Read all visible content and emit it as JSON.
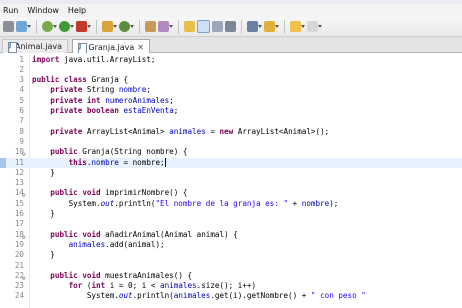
{
  "menubar": {
    "items": [
      "Run",
      "Window",
      "Help"
    ]
  },
  "toolbar": {
    "icons": [
      "print-icon",
      "new-icon",
      "debug-icon",
      "run-icon",
      "external-tools-icon",
      "new-project-icon",
      "new-class-icon",
      "open-type-icon",
      "search-icon",
      "toggle-mark-occurrences-icon",
      "show-whitespace-icon",
      "block-selection-icon",
      "next-annotation-icon",
      "previous-annotation-icon",
      "last-edit-icon",
      "back-icon",
      "forward-icon"
    ]
  },
  "tabs": [
    {
      "label": "Animal.java",
      "active": false
    },
    {
      "label": "Granja.java",
      "active": true,
      "close": "✕"
    }
  ],
  "editor": {
    "current_line": 11,
    "lines": [
      {
        "n": "1",
        "tokens": [
          [
            "kw",
            "import"
          ],
          [
            "t",
            " java.util.ArrayList;"
          ]
        ]
      },
      {
        "n": "2",
        "tokens": []
      },
      {
        "n": "3",
        "tokens": [
          [
            "kw",
            "public"
          ],
          [
            "t",
            " "
          ],
          [
            "kw",
            "class"
          ],
          [
            "t",
            " Granja {"
          ]
        ]
      },
      {
        "n": "4",
        "tokens": [
          [
            "t",
            "    "
          ],
          [
            "kw",
            "private"
          ],
          [
            "t",
            " String "
          ],
          [
            "fld",
            "nombre"
          ],
          [
            "t",
            ";"
          ]
        ]
      },
      {
        "n": "5",
        "tokens": [
          [
            "t",
            "    "
          ],
          [
            "kw",
            "private"
          ],
          [
            "t",
            " "
          ],
          [
            "kw",
            "int"
          ],
          [
            "t",
            " "
          ],
          [
            "fld",
            "numeroAnimales"
          ],
          [
            "t",
            ";"
          ]
        ]
      },
      {
        "n": "6",
        "tokens": [
          [
            "t",
            "    "
          ],
          [
            "kw",
            "private"
          ],
          [
            "t",
            " "
          ],
          [
            "kw",
            "boolean"
          ],
          [
            "t",
            " "
          ],
          [
            "fld",
            "estaEnVenta"
          ],
          [
            "t",
            ";"
          ]
        ]
      },
      {
        "n": "7",
        "tokens": []
      },
      {
        "n": "8",
        "tokens": [
          [
            "t",
            "    "
          ],
          [
            "kw",
            "private"
          ],
          [
            "t",
            " ArrayList<Animal> "
          ],
          [
            "fld",
            "animales"
          ],
          [
            "t",
            " = "
          ],
          [
            "kw",
            "new"
          ],
          [
            "t",
            " ArrayList<Animal>();"
          ]
        ]
      },
      {
        "n": "9",
        "tokens": []
      },
      {
        "n": "10",
        "fold": "⊖",
        "tokens": [
          [
            "t",
            "    "
          ],
          [
            "kw",
            "public"
          ],
          [
            "t",
            " Granja(String nombre) {"
          ]
        ]
      },
      {
        "n": "11",
        "tokens": [
          [
            "t",
            "        "
          ],
          [
            "kw",
            "this"
          ],
          [
            "t",
            "."
          ],
          [
            "fld",
            "nombre"
          ],
          [
            "t",
            " = nombre;"
          ]
        ]
      },
      {
        "n": "12",
        "tokens": [
          [
            "t",
            "    }"
          ]
        ]
      },
      {
        "n": "13",
        "tokens": []
      },
      {
        "n": "14",
        "fold": "⊖",
        "tokens": [
          [
            "t",
            "    "
          ],
          [
            "kw",
            "public"
          ],
          [
            "t",
            " "
          ],
          [
            "kw",
            "void"
          ],
          [
            "t",
            " imprimirNombre() {"
          ]
        ]
      },
      {
        "n": "15",
        "tokens": [
          [
            "t",
            "        System."
          ],
          [
            "fldst",
            "out"
          ],
          [
            "t",
            ".println("
          ],
          [
            "str",
            "\"El nombre de la granja es: \""
          ],
          [
            "t",
            " + "
          ],
          [
            "fld",
            "nombre"
          ],
          [
            "t",
            ");"
          ]
        ]
      },
      {
        "n": "16",
        "tokens": [
          [
            "t",
            "    }"
          ]
        ]
      },
      {
        "n": "17",
        "tokens": []
      },
      {
        "n": "18",
        "fold": "⊖",
        "tokens": [
          [
            "t",
            "    "
          ],
          [
            "kw",
            "public"
          ],
          [
            "t",
            " "
          ],
          [
            "kw",
            "void"
          ],
          [
            "t",
            " añadirAnimal(Animal animal) {"
          ]
        ]
      },
      {
        "n": "19",
        "tokens": [
          [
            "t",
            "        "
          ],
          [
            "fld",
            "animales"
          ],
          [
            "t",
            ".add(animal);"
          ]
        ]
      },
      {
        "n": "20",
        "tokens": [
          [
            "t",
            "    }"
          ]
        ]
      },
      {
        "n": "21",
        "tokens": []
      },
      {
        "n": "22",
        "fold": "⊖",
        "tokens": [
          [
            "t",
            "    "
          ],
          [
            "kw",
            "public"
          ],
          [
            "t",
            " "
          ],
          [
            "kw",
            "void"
          ],
          [
            "t",
            " muestraAnimales() {"
          ]
        ]
      },
      {
        "n": "23",
        "tokens": [
          [
            "t",
            "        "
          ],
          [
            "kw",
            "for"
          ],
          [
            "t",
            " ("
          ],
          [
            "kw",
            "int"
          ],
          [
            "t",
            " i = 0; i < "
          ],
          [
            "fld",
            "animales"
          ],
          [
            "t",
            ".size(); i++)"
          ]
        ]
      },
      {
        "n": "24",
        "tokens": [
          [
            "t",
            "            System."
          ],
          [
            "fldst",
            "out"
          ],
          [
            "t",
            ".println("
          ],
          [
            "fld",
            "animales"
          ],
          [
            "t",
            ".get(i).getNombre() + "
          ],
          [
            "str",
            "\" con peso \""
          ]
        ]
      }
    ]
  },
  "colors": {
    "keyword": "#7f0055",
    "field": "#0000c0",
    "string": "#2a00ff",
    "current_line": "#e8f2fe"
  }
}
